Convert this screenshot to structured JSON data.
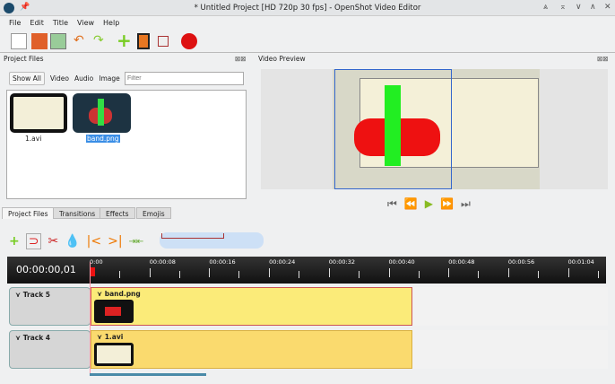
{
  "window": {
    "title": "* Untitled Project [HD 720p 30 fps] - OpenShot Video Editor",
    "controls": [
      "⩓",
      "⌅",
      "∨",
      "∧",
      "✕"
    ]
  },
  "menu": [
    "File",
    "Edit",
    "Title",
    "View",
    "Help"
  ],
  "toolbar": {
    "icons": [
      "new-project-icon",
      "open-project-icon",
      "save-project-icon",
      "undo-icon",
      "redo-icon",
      "import-files-icon",
      "profile-icon",
      "fullscreen-icon",
      "export-video-icon"
    ]
  },
  "project_files": {
    "title": "Project Files",
    "filters": [
      "Show All",
      "Video",
      "Audio",
      "Image"
    ],
    "filter_placeholder": "Filter",
    "files": [
      {
        "name": "1.avi"
      },
      {
        "name": "band.png",
        "selected": true
      }
    ]
  },
  "tabs": [
    "Project Files",
    "Transitions",
    "Effects",
    "Emojis"
  ],
  "preview": {
    "title": "Video Preview"
  },
  "timeline": {
    "timecode": "00:00:00,01",
    "ticks": [
      "0:00",
      "00:00:08",
      "00:00:16",
      "00:00:24",
      "00:00:32",
      "00:00:40",
      "00:00:48",
      "00:00:56",
      "00:01:04"
    ],
    "tracks": [
      {
        "name": "Track 5",
        "clip": "band.png"
      },
      {
        "name": "Track 4",
        "clip": "1.avi"
      }
    ]
  }
}
